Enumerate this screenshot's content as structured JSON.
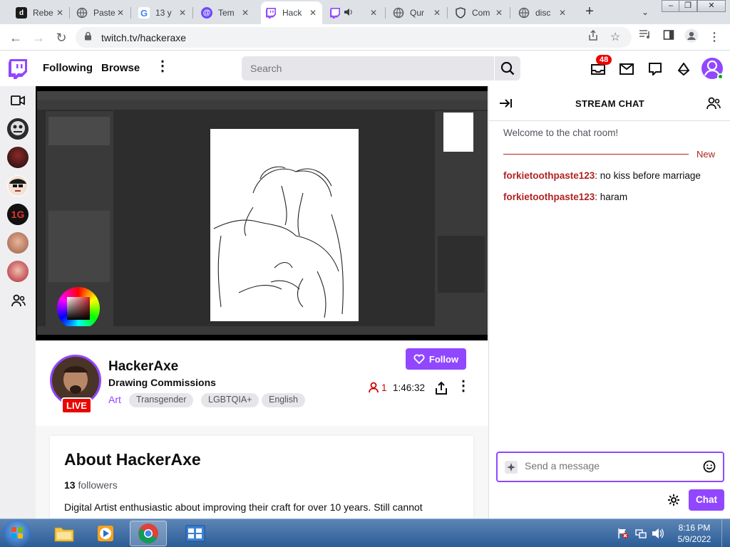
{
  "browser": {
    "tabs": [
      {
        "title": "Rebe",
        "favicon": "d",
        "color": "#1b1b1b"
      },
      {
        "title": "Paste",
        "favicon": "globe",
        "color": "#5f6368"
      },
      {
        "title": "13 y",
        "favicon": "G",
        "color": "#4285f4"
      },
      {
        "title": "Tem",
        "favicon": "@",
        "color": "#6b48ff"
      },
      {
        "title": "Hack",
        "favicon": "twitch",
        "color": "#9147ff"
      },
      {
        "title": "",
        "favicon": "twitch",
        "color": "#9147ff"
      },
      {
        "title": "Qur",
        "favicon": "globe",
        "color": "#5f6368"
      },
      {
        "title": "Com",
        "favicon": "shield",
        "color": "#5f6368"
      },
      {
        "title": "disc",
        "favicon": "globe",
        "color": "#5f6368"
      }
    ],
    "active_tab": 4,
    "url": "twitch.tv/hackeraxe"
  },
  "nav": {
    "following": "Following",
    "browse": "Browse",
    "search_placeholder": "Search",
    "notification_count": "48"
  },
  "channel": {
    "name": "HackerAxe",
    "title": "Drawing Commissions",
    "category": "Art",
    "tags": [
      "Transgender",
      "LGBTQIA+",
      "English"
    ],
    "live_label": "LIVE",
    "follow_label": "Follow",
    "viewers": "1",
    "uptime": "1:46:32"
  },
  "about": {
    "heading": "About HackerAxe",
    "followers_count": "13",
    "followers_label": "followers",
    "bio": "Digital Artist enthusiastic about improving their craft for over 10 years. Still cannot"
  },
  "chat": {
    "header": "STREAM CHAT",
    "welcome": "Welcome to the chat room!",
    "new_label": "New",
    "messages": [
      {
        "user": "forkietoothpaste123",
        "text": ": no kiss before marriage"
      },
      {
        "user": "forkietoothpaste123",
        "text": ": haram"
      }
    ],
    "input_placeholder": "Send a message",
    "send_label": "Chat"
  },
  "taskbar": {
    "time": "8:16 PM",
    "date": "5/9/2022"
  },
  "colors": {
    "twitch_purple": "#9147ff",
    "live_red": "#eb0400",
    "chat_user": "#b22222"
  }
}
